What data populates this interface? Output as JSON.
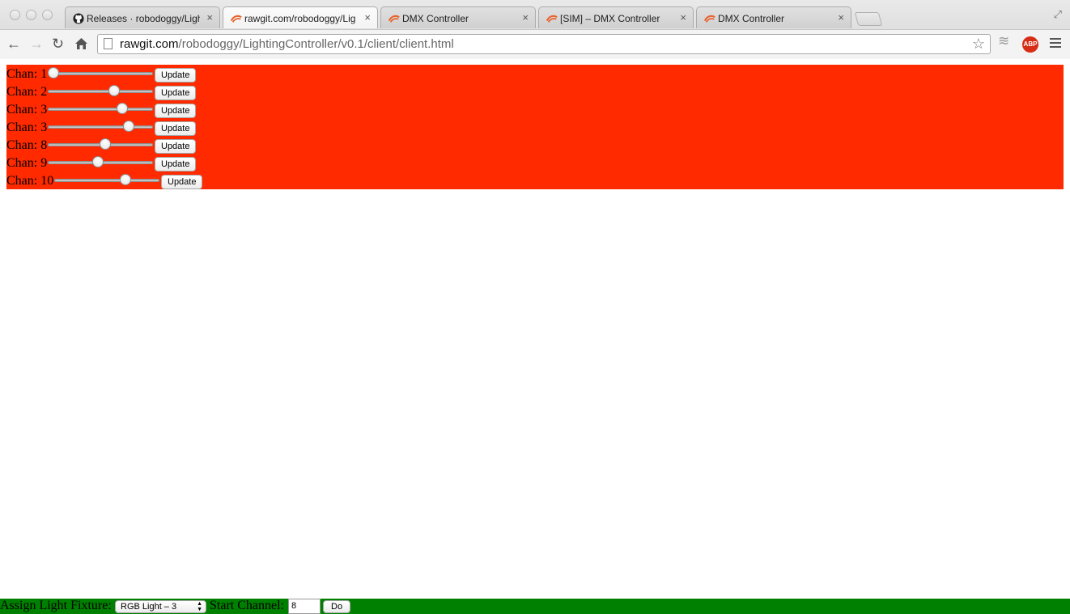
{
  "browser": {
    "tabs": [
      {
        "title": "Releases · robodoggy/Ligh",
        "icon": "github-icon",
        "active": false
      },
      {
        "title": "rawgit.com/robodoggy/Lig",
        "icon": "rawgit-icon",
        "active": true
      },
      {
        "title": "DMX Controller",
        "icon": "rawgit-icon",
        "active": false
      },
      {
        "title": "[SIM] – DMX Controller",
        "icon": "rawgit-icon",
        "active": false
      },
      {
        "title": "DMX Controller",
        "icon": "rawgit-icon",
        "active": false
      }
    ],
    "close_glyph": "×",
    "url_host": "rawgit.com",
    "url_path": "/robodoggy/LightingController/v0.1/client/client.html",
    "abp_label": "ABP"
  },
  "channels": {
    "panel_color": "#ff2a00",
    "rows": [
      {
        "label": "Chan: 1",
        "value": 0.0,
        "button": "Update"
      },
      {
        "label": "Chan: 2",
        "value": 0.65,
        "button": "Update"
      },
      {
        "label": "Chan: 3",
        "value": 0.73,
        "button": "Update"
      },
      {
        "label": "Chan: 3",
        "value": 0.8,
        "button": "Update"
      },
      {
        "label": "Chan: 8",
        "value": 0.55,
        "button": "Update"
      },
      {
        "label": "Chan: 9",
        "value": 0.47,
        "button": "Update"
      },
      {
        "label": "Chan: 10",
        "value": 0.7,
        "button": "Update"
      }
    ]
  },
  "assign": {
    "bar_color": "#008000",
    "fixture_label": "Assign Light Fixture:",
    "fixture_selected": "RGB Light – 3",
    "start_label": "Start Channel:",
    "start_value": "8",
    "do_label": "Do"
  }
}
